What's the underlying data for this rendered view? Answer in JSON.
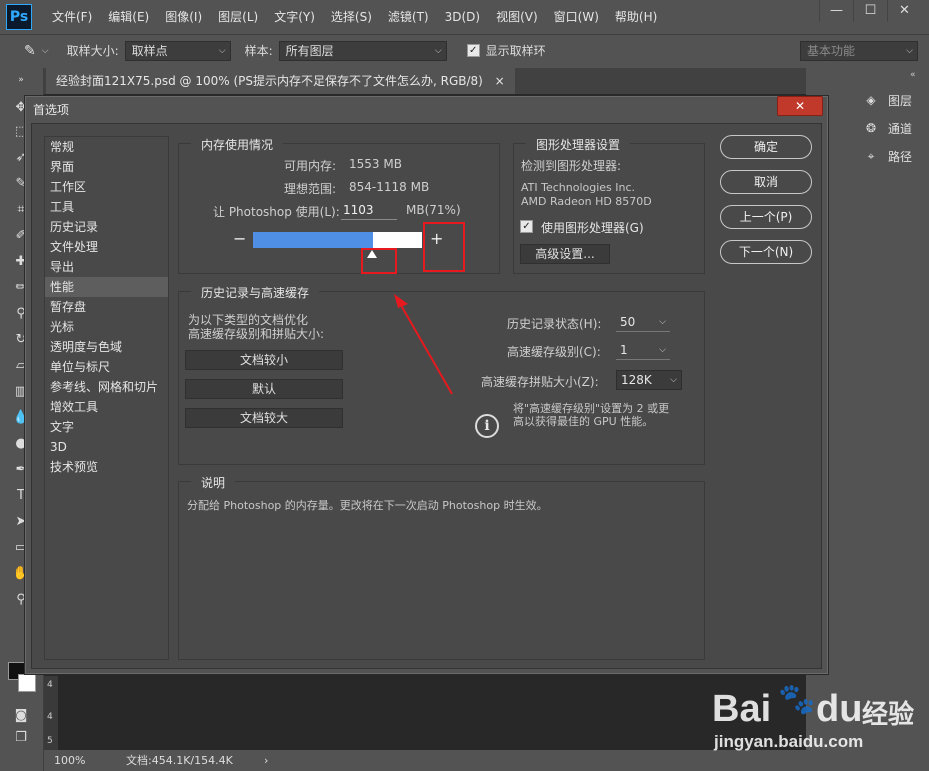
{
  "menubar": {
    "logo": "Ps",
    "items": [
      "文件(F)",
      "编辑(E)",
      "图像(I)",
      "图层(L)",
      "文字(Y)",
      "选择(S)",
      "滤镜(T)",
      "3D(D)",
      "视图(V)",
      "窗口(W)",
      "帮助(H)"
    ]
  },
  "optbar": {
    "sample_size_label": "取样大小:",
    "sample_size_value": "取样点",
    "sample_label": "样本:",
    "sample_value": "所有图层",
    "show_ring_label": "显示取样环",
    "workspace": "基本功能"
  },
  "doc_tab": {
    "title": "经验封面121X75.psd @ 100% (PS提示内存不足保存不了文件怎么办, RGB/8)",
    "close": "×"
  },
  "right_panel": {
    "items": [
      "图层",
      "通道",
      "路径"
    ]
  },
  "statusbar": {
    "zoom": "100%",
    "doc_info": "文档:454.1K/154.4K"
  },
  "ruler_marks": [
    "4",
    "4",
    "5"
  ],
  "dialog": {
    "title": "首选项",
    "close": "✕",
    "categories": [
      "常规",
      "界面",
      "工作区",
      "工具",
      "历史记录",
      "文件处理",
      "导出",
      "性能",
      "暂存盘",
      "光标",
      "透明度与色域",
      "单位与标尺",
      "参考线、网格和切片",
      "增效工具",
      "文字",
      "3D",
      "技术预览"
    ],
    "active_category": "性能",
    "memory": {
      "title": "内存使用情况",
      "available_label": "可用内存:",
      "available_value": "1553 MB",
      "ideal_label": "理想范围:",
      "ideal_value": "854-1118 MB",
      "let_label": "让 Photoshop 使用(L):",
      "let_value": "1103",
      "unit": "MB(71%)",
      "minus": "−",
      "plus": "+",
      "percent": 71
    },
    "gpu": {
      "title": "图形处理器设置",
      "detected_label": "检测到图形处理器:",
      "vendor": "ATI Technologies Inc.",
      "model": "AMD Radeon HD 8570D",
      "use_gpu_label": "使用图形处理器(G)",
      "advanced_button": "高级设置..."
    },
    "history": {
      "title": "历史记录与高速缓存",
      "desc_line1": "为以下类型的文档优化",
      "desc_line2": "高速缓存级别和拼贴大小:",
      "btn_small": "文档较小",
      "btn_default": "默认",
      "btn_large": "文档较大",
      "states_label": "历史记录状态(H):",
      "states_value": "50",
      "cache_levels_label": "高速缓存级别(C):",
      "cache_levels_value": "1",
      "tile_size_label": "高速缓存拼贴大小(Z):",
      "tile_size_value": "128K",
      "hint_line1": "将\"高速缓存级别\"设置为 2 或更",
      "hint_line2": "高以获得最佳的 GPU 性能。"
    },
    "description": {
      "title": "说明",
      "text": "分配给 Photoshop 的内存量。更改将在下一次启动 Photoshop 时生效。"
    },
    "buttons": {
      "ok": "确定",
      "cancel": "取消",
      "prev": "上一个(P)",
      "next": "下一个(N)"
    }
  },
  "watermark": {
    "brand": "Bai",
    "brand2": "du",
    "cn": "经验",
    "url": "jingyan.baidu.com"
  },
  "colors": {
    "accent_blue": "#4f8fe6",
    "annotation_red": "#e5191e",
    "close_red": "#c0392b"
  }
}
